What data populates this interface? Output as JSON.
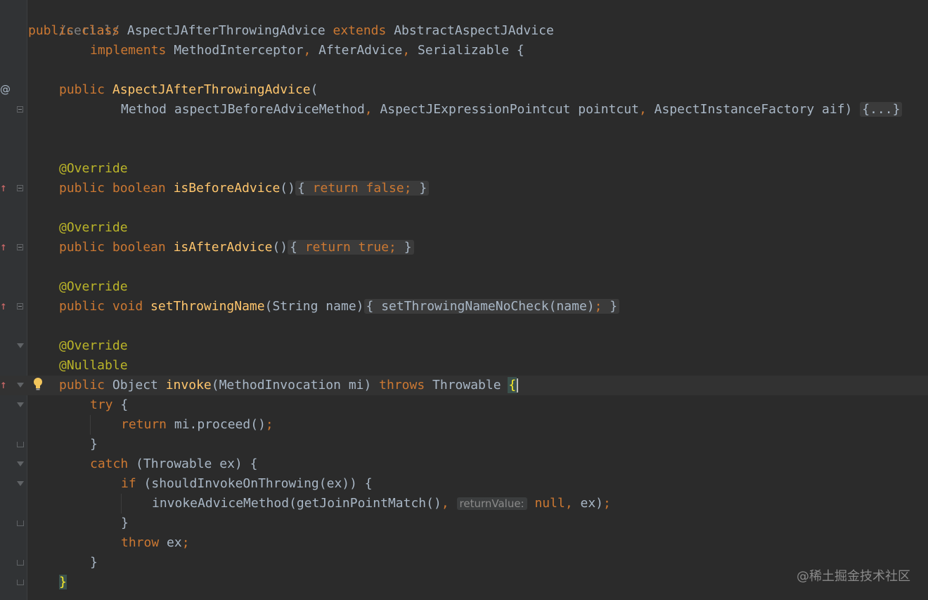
{
  "lines": {
    "l1": "/serial/",
    "l2": {
      "kw1": "public class ",
      "cls": "AspectJAfterThrowingAdvice",
      "kw2": " extends ",
      "parent": "AbstractAspectJAdvice"
    },
    "l3": {
      "kw": "implements ",
      "i1": "MethodInterceptor",
      "c1": ", ",
      "i2": "AfterAdvice",
      "c2": ", ",
      "i3": "Serializable {"
    },
    "l5": {
      "kw": "public ",
      "fn": "AspectJAfterThrowingAdvice",
      "p": "("
    },
    "l6": {
      "t1": "Method aspectJBeforeAdviceMethod",
      "c1": ", ",
      "t2": "AspectJExpressionPointcut pointcut",
      "c2": ", ",
      "t3": "AspectInstanceFactory aif) ",
      "fold": "{...}"
    },
    "l9": "@Override",
    "l10": {
      "kw": "public boolean ",
      "fn": "isBeforeAdvice",
      "p": "()",
      "o": "{ ",
      "ret": "return false",
      "semi": ";",
      "c": " }"
    },
    "l12": "@Override",
    "l13": {
      "kw": "public boolean ",
      "fn": "isAfterAdvice",
      "p": "()",
      "o": "{ ",
      "ret": "return true",
      "semi": ";",
      "c": " }"
    },
    "l15": "@Override",
    "l16": {
      "kw": "public void ",
      "fn": "setThrowingName",
      "p": "(String name)",
      "o": "{ ",
      "body": "setThrowingNameNoCheck(name)",
      "semi": ";",
      "c": " }"
    },
    "l18": "@Override",
    "l19": "@Nullable",
    "l20": {
      "kw": "public ",
      "type": "Object ",
      "fn": "invoke",
      "p": "(MethodInvocation mi) ",
      "kw2": "throws ",
      "t": "Throwable ",
      "brace": "{"
    },
    "l21": {
      "kw": "try",
      "b": " {"
    },
    "l22": {
      "kw": "return ",
      "body": "mi.proceed()",
      "semi": ";"
    },
    "l23": "}",
    "l24": {
      "kw": "catch",
      "b": " (Throwable ex) {"
    },
    "l25": {
      "kw": "if",
      "b": " (shouldInvokeOnThrowing(ex)) {"
    },
    "l26": {
      "call": "invokeAdviceMethod(getJoinPointMatch()",
      "c": ", ",
      "hint": "returnValue:",
      "nul": "null",
      "c2": ", ",
      "ex": "ex)",
      "semi": ";"
    },
    "l27": "}",
    "l28": {
      "kw": "throw ",
      "b": "ex",
      "semi": ";"
    },
    "l29": "}",
    "l30": "}"
  },
  "gutter": {
    "override_marker": "↑",
    "at_marker": "@"
  },
  "watermark": "@稀土掘金技术社区",
  "colors": {
    "background": "#2b2b2b",
    "keyword": "#cc7832",
    "function": "#ffc66d",
    "annotation": "#bbb529",
    "text": "#a9b7c6"
  }
}
